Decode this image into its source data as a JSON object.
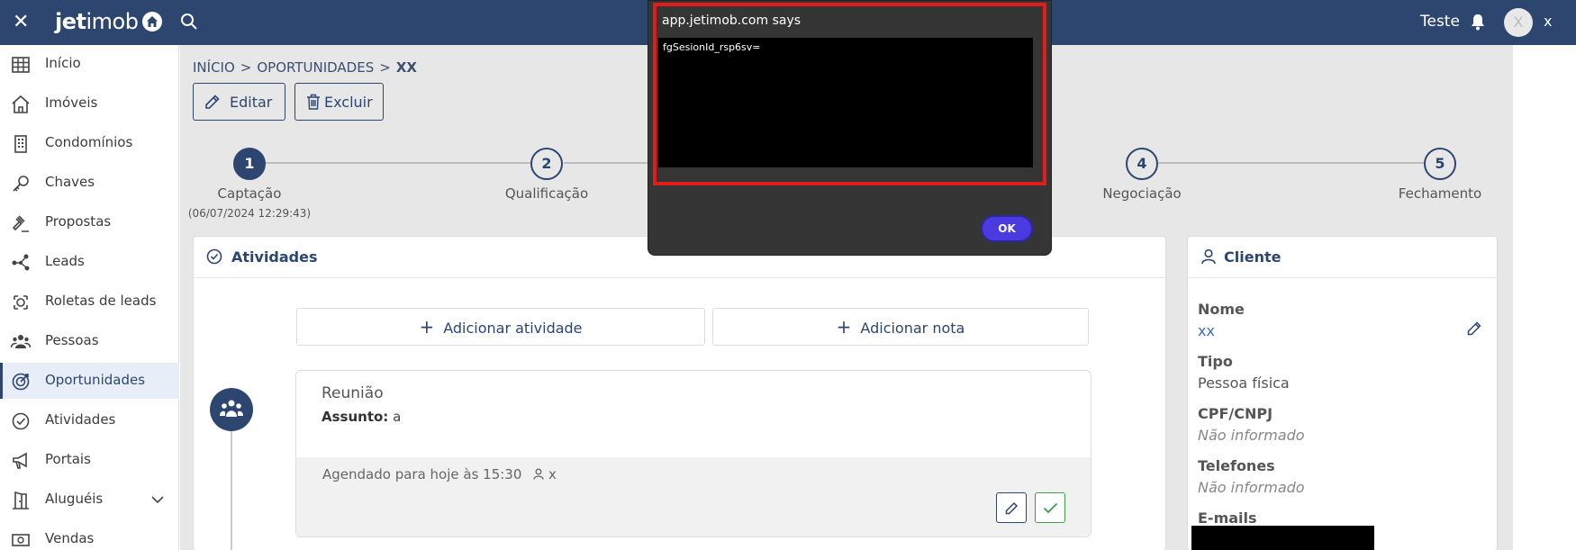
{
  "topbar": {
    "logo_bold": "jet",
    "logo_rest": "imob",
    "user_name": "Teste",
    "avatar_initial": "X",
    "close_label": "x"
  },
  "sidebar": {
    "items": [
      {
        "label": "Início",
        "icon": "grid-icon"
      },
      {
        "label": "Imóveis",
        "icon": "house-icon"
      },
      {
        "label": "Condomínios",
        "icon": "building-icon"
      },
      {
        "label": "Chaves",
        "icon": "key-icon"
      },
      {
        "label": "Propostas",
        "icon": "gavel-icon"
      },
      {
        "label": "Leads",
        "icon": "network-icon"
      },
      {
        "label": "Roletas de leads",
        "icon": "roulette-icon"
      },
      {
        "label": "Pessoas",
        "icon": "people-icon"
      },
      {
        "label": "Oportunidades",
        "icon": "target-icon"
      },
      {
        "label": "Atividades",
        "icon": "check-circle-icon"
      },
      {
        "label": "Portais",
        "icon": "megaphone-icon"
      },
      {
        "label": "Aluguéis",
        "icon": "door-icon"
      },
      {
        "label": "Vendas",
        "icon": "money-icon"
      }
    ],
    "active_index": 8
  },
  "breadcrumb": {
    "items": [
      "INÍCIO",
      "OPORTUNIDADES",
      "XX"
    ],
    "separator": ">"
  },
  "actions": {
    "edit_label": "Editar",
    "delete_label": "Excluir"
  },
  "stepper": {
    "steps": [
      {
        "number": "1",
        "label": "Captação",
        "date": "(06/07/2024 12:29:43)"
      },
      {
        "number": "2",
        "label": "Qualificação"
      },
      {
        "number": "4",
        "label": "Negociação"
      },
      {
        "number": "5",
        "label": "Fechamento"
      }
    ]
  },
  "activities": {
    "header": "Atividades",
    "add_activity": "Adicionar atividade",
    "add_note": "Adicionar nota",
    "item": {
      "title": "Reunião",
      "subject_label": "Assunto:",
      "subject_value": "a",
      "schedule": "Agendado para hoje às 15:30",
      "assignee": "x"
    }
  },
  "cliente": {
    "header": "Cliente",
    "fields": [
      {
        "label": "Nome",
        "value": "xx"
      },
      {
        "label": "Tipo",
        "value": "Pessoa física"
      },
      {
        "label": "CPF/CNPJ",
        "value": "Não informado"
      },
      {
        "label": "Telefones",
        "value": "Não informado"
      },
      {
        "label": "E-mails"
      }
    ]
  },
  "dialog": {
    "title": "app.jetimob.com says",
    "message": "fgSesionId_rsp6sv=",
    "ok_label": "OK"
  }
}
